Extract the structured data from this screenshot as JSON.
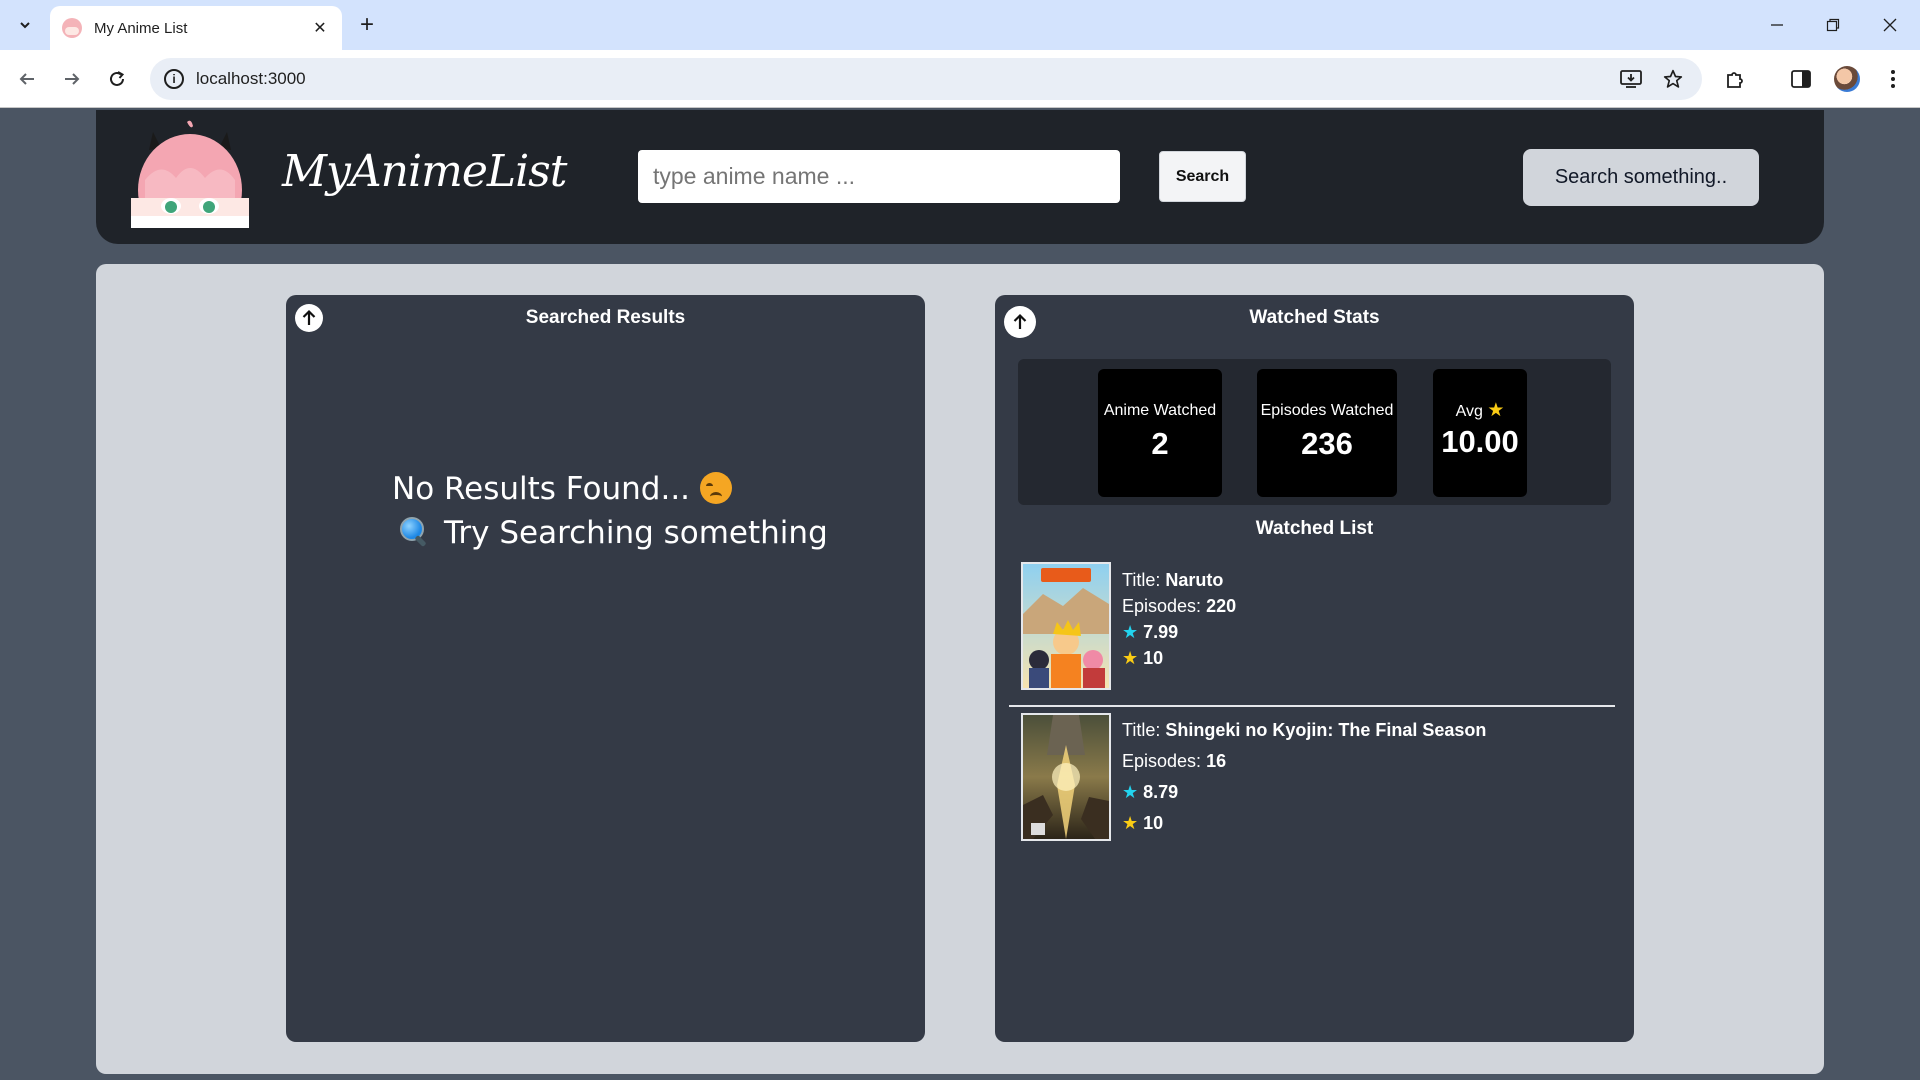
{
  "browser": {
    "tab_title": "My Anime List",
    "url": "localhost:3000",
    "icons": [
      "tab-dropdown-icon",
      "close-icon",
      "new-tab-icon",
      "minimize-icon",
      "restore-icon",
      "window-close-icon",
      "back-icon",
      "forward-icon",
      "reload-icon",
      "site-info-icon",
      "install-app-icon",
      "bookmark-star-icon",
      "extensions-icon",
      "side-panel-icon",
      "profile-avatar",
      "menu-icon"
    ]
  },
  "header": {
    "logo_text": "MyAnimeList",
    "search_placeholder": "type anime name ...",
    "search_button": "Search",
    "status_text": "Search something.."
  },
  "search_panel": {
    "title": "Searched Results",
    "empty_line1": "No Results Found...",
    "empty_line2": "Try Searching something"
  },
  "watched_panel": {
    "title": "Watched Stats",
    "stats": {
      "anime_label": "Anime Watched",
      "anime_value": "2",
      "episodes_label": "Episodes Watched",
      "episodes_value": "236",
      "avg_label": "Avg",
      "avg_value": "10.00"
    },
    "list_title": "Watched List",
    "title_prefix": "Title:",
    "episodes_prefix": "Episodes:",
    "items": [
      {
        "title": "Naruto",
        "episodes": "220",
        "imdb_rating": "7.99",
        "user_rating": "10"
      },
      {
        "title": "Shingeki no Kyojin: The Final Season",
        "episodes": "16",
        "imdb_rating": "8.79",
        "user_rating": "10"
      }
    ]
  },
  "colors": {
    "page_bg": "#4b5563",
    "navbar_bg": "#1f2329",
    "main_bg": "#d1d5db",
    "panel_bg": "#343a46",
    "star_gold": "#facc15",
    "star_cyan": "#22d3ee"
  }
}
